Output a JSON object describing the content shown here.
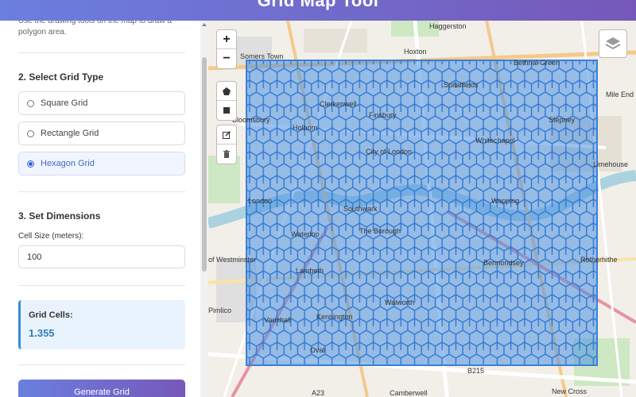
{
  "header": {
    "title": "Grid Map Tool"
  },
  "sidebar": {
    "draw_hint_line1": "Use the drawing tools on the map to draw a",
    "draw_hint_line2": "polygon area.",
    "grid_type_title": "2. Select Grid Type",
    "grid_options": [
      {
        "label": "Square Grid",
        "selected": false
      },
      {
        "label": "Rectangle Grid",
        "selected": false
      },
      {
        "label": "Hexagon Grid",
        "selected": true
      }
    ],
    "dimensions_title": "3. Set Dimensions",
    "cell_size_label": "Cell Size (meters):",
    "cell_size_value": "100",
    "grid_cells_label": "Grid Cells:",
    "grid_cells_value": "1.355",
    "generate_label": "Generate Grid"
  },
  "map": {
    "zoom_in": "+",
    "zoom_out": "−",
    "labels": [
      "Haggerston",
      "Hoxton",
      "Bethnal Green",
      "Mile End",
      "Somers Town",
      "Bloomsbury",
      "Holborn",
      "Clerkenwell",
      "Finsbury",
      "City of London",
      "Spitalfields",
      "Whitechapel",
      "Stepney",
      "Limehouse",
      "Wapping",
      "London",
      "Southwark",
      "The Borough",
      "Waterloo",
      "of Westminster",
      "Lambeth",
      "Walworth",
      "Bermondsey",
      "Rotherhithe",
      "Kennington",
      "Vauxhall",
      "Pimlico",
      "Oval",
      "Camberwell",
      "New Cross",
      "B215",
      "A23"
    ],
    "colors": {
      "grid_fill": "#4a90e2",
      "grid_stroke": "#3b7fd6"
    }
  }
}
